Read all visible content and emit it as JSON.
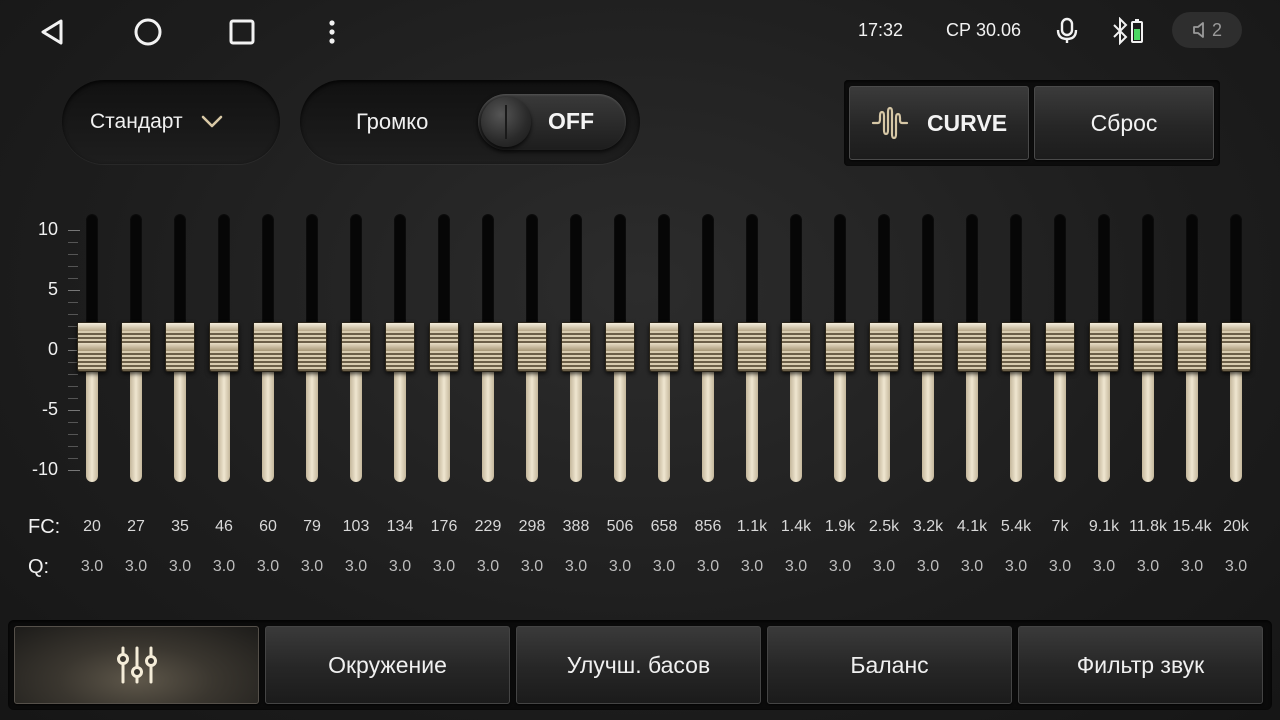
{
  "status": {
    "time": "17:32",
    "date": "СР 30.06",
    "volume": "2"
  },
  "preset": {
    "label": "Стандарт"
  },
  "loudness": {
    "label": "Громко",
    "state": "OFF"
  },
  "buttons": {
    "curve": "CURVE",
    "reset": "Сброс"
  },
  "scale": [
    "10",
    "5",
    "0",
    "-5",
    "-10"
  ],
  "eq": {
    "fc_label": "FC:",
    "q_label": "Q:",
    "range": [
      -10,
      10
    ],
    "bands": [
      {
        "fc": "20",
        "q": "3.0",
        "gain": 0
      },
      {
        "fc": "27",
        "q": "3.0",
        "gain": 0
      },
      {
        "fc": "35",
        "q": "3.0",
        "gain": 0
      },
      {
        "fc": "46",
        "q": "3.0",
        "gain": 0
      },
      {
        "fc": "60",
        "q": "3.0",
        "gain": 0
      },
      {
        "fc": "79",
        "q": "3.0",
        "gain": 0
      },
      {
        "fc": "103",
        "q": "3.0",
        "gain": 0
      },
      {
        "fc": "134",
        "q": "3.0",
        "gain": 0
      },
      {
        "fc": "176",
        "q": "3.0",
        "gain": 0
      },
      {
        "fc": "229",
        "q": "3.0",
        "gain": 0
      },
      {
        "fc": "298",
        "q": "3.0",
        "gain": 0
      },
      {
        "fc": "388",
        "q": "3.0",
        "gain": 0
      },
      {
        "fc": "506",
        "q": "3.0",
        "gain": 0
      },
      {
        "fc": "658",
        "q": "3.0",
        "gain": 0
      },
      {
        "fc": "856",
        "q": "3.0",
        "gain": 0
      },
      {
        "fc": "1.1k",
        "q": "3.0",
        "gain": 0
      },
      {
        "fc": "1.4k",
        "q": "3.0",
        "gain": 0
      },
      {
        "fc": "1.9k",
        "q": "3.0",
        "gain": 0
      },
      {
        "fc": "2.5k",
        "q": "3.0",
        "gain": 0
      },
      {
        "fc": "3.2k",
        "q": "3.0",
        "gain": 0
      },
      {
        "fc": "4.1k",
        "q": "3.0",
        "gain": 0
      },
      {
        "fc": "5.4k",
        "q": "3.0",
        "gain": 0
      },
      {
        "fc": "7k",
        "q": "3.0",
        "gain": 0
      },
      {
        "fc": "9.1k",
        "q": "3.0",
        "gain": 0
      },
      {
        "fc": "11.8k",
        "q": "3.0",
        "gain": 0
      },
      {
        "fc": "15.4k",
        "q": "3.0",
        "gain": 0
      },
      {
        "fc": "20k",
        "q": "3.0",
        "gain": 0
      }
    ]
  },
  "tabs": [
    {
      "icon": "equalizer-sliders-icon",
      "label": ""
    },
    {
      "label": "Окружение"
    },
    {
      "label": "Улучш. басов"
    },
    {
      "label": "Баланс"
    },
    {
      "label": "Фильтр звук"
    }
  ],
  "colors": {
    "accent": "#e6dcc4",
    "background": "#1f1f1f"
  }
}
